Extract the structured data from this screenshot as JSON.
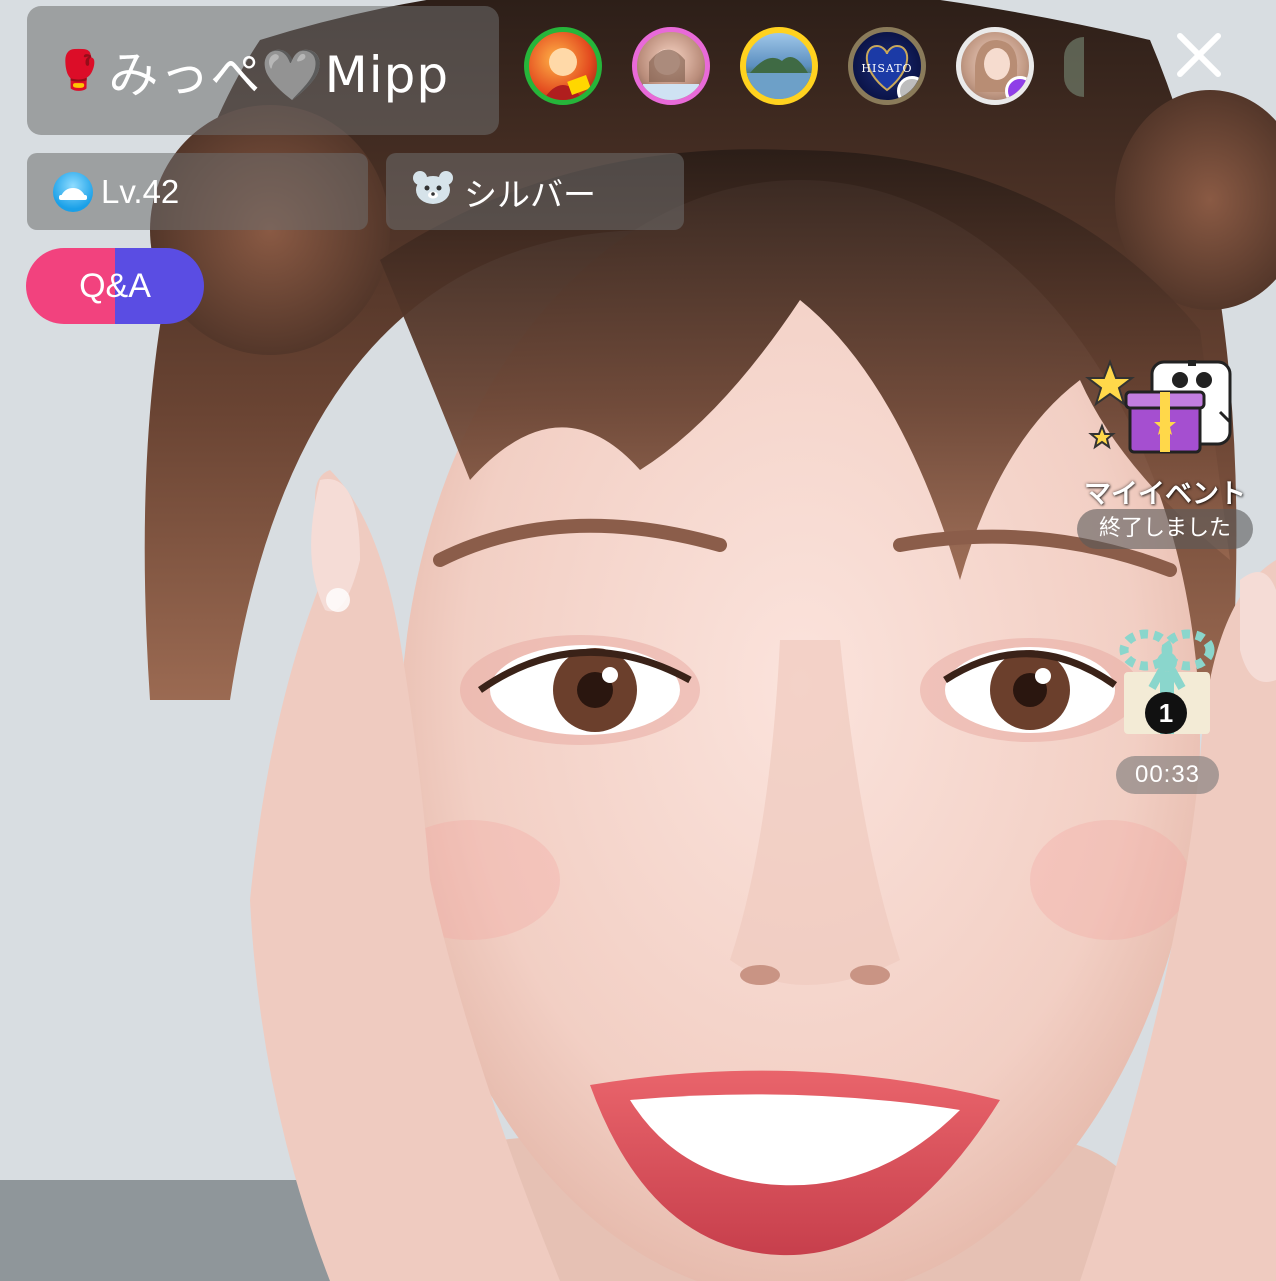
{
  "broadcaster": {
    "name_emoji": "🥊",
    "name": "みっぺ🩶Mipp"
  },
  "viewers": [
    {
      "icon": "viewer-avatar-1",
      "ring_color": "#26b53a"
    },
    {
      "icon": "viewer-avatar-2",
      "ring_color": "#e86ad8"
    },
    {
      "icon": "viewer-avatar-3",
      "ring_color": "#ffd21f"
    },
    {
      "icon": "viewer-avatar-4",
      "ring_color": "#8a7b5a",
      "label": "HISATO"
    },
    {
      "icon": "viewer-avatar-5",
      "ring_color": "#eaeaea",
      "verified_color": "#8f3fe8"
    }
  ],
  "close": {
    "icon": "close-icon"
  },
  "level": {
    "icon": "level-badge-icon",
    "label": "Lv.42"
  },
  "rank": {
    "icon": "bear-icon",
    "label": "シルバー"
  },
  "qa": {
    "label": "Q&A",
    "colors": [
      "#f2427e",
      "#5a4de3"
    ]
  },
  "event": {
    "icon": "event-gift-mascot-icon",
    "title": "マイイベント",
    "status": "終了しました"
  },
  "gift": {
    "icon": "gift-box-icon",
    "count": "1",
    "timer": "00:33"
  }
}
